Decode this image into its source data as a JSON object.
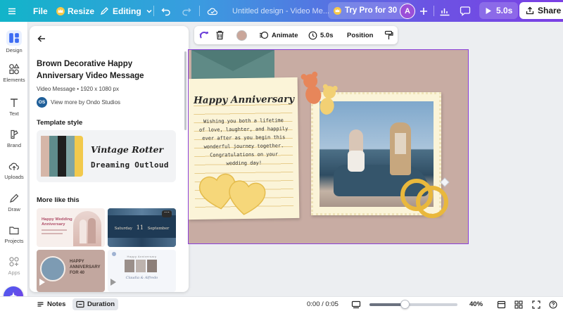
{
  "topbar": {
    "file_label": "File",
    "resize_label": "Resize",
    "editing_label": "Editing",
    "doc_title": "Untitled design - Video Me...",
    "try_pro_label": "Try Pro for 30 ...",
    "avatar_initial": "A",
    "duration_label": "5.0s",
    "share_label": "Share"
  },
  "rail": {
    "items": [
      {
        "label": "Design",
        "icon": "design-icon"
      },
      {
        "label": "Elements",
        "icon": "elements-icon"
      },
      {
        "label": "Text",
        "icon": "text-icon"
      },
      {
        "label": "Brand",
        "icon": "brand-icon"
      },
      {
        "label": "Uploads",
        "icon": "uploads-icon"
      },
      {
        "label": "Draw",
        "icon": "draw-icon"
      },
      {
        "label": "Projects",
        "icon": "projects-icon"
      },
      {
        "label": "Apps",
        "icon": "apps-icon"
      }
    ]
  },
  "panel": {
    "title": "Brown Decorative Happy Anniversary Video Message",
    "meta": "Video Message • 1920 x 1080 px",
    "author_badge": "OS",
    "author_link": "View more by Ondo Studios",
    "template_style_heading": "Template style",
    "palette": [
      "#d5b6a8",
      "#5f8c8c",
      "#1f1f1f",
      "#7fa4a4",
      "#f2c94c"
    ],
    "font_sample_1": "Vintage Rotter",
    "font_sample_2": "Dreaming Outloud",
    "more_like_this_heading": "More like this",
    "thumbnails": [
      {
        "text_1": "Happy Wedding",
        "text_2": "Anniversary"
      },
      {
        "text_1": "Saturday",
        "text_2": "11",
        "text_3": "September"
      },
      {
        "text_1": "HAPPY",
        "text_2": "ANNIVERSARY",
        "text_3": "FOR 40"
      },
      {
        "text_1": "Happy Anniversary",
        "text_2": "Claudia & Alfredo"
      }
    ]
  },
  "toolbar": {
    "animate_label": "Animate",
    "duration_label": "5.0s",
    "position_label": "Position",
    "color_swatch": "#c9a69a"
  },
  "canvas": {
    "heading": "Happy Anniversary",
    "message": [
      "Wishing you both a lifetime",
      "of love, laughter, and happily",
      "ever after as you begin this",
      "wonderful journey together.",
      "Congratulations on your",
      "wedding day!"
    ],
    "background": "#c8aca3"
  },
  "bottombar": {
    "notes_label": "Notes",
    "duration_label": "Duration",
    "time_label": "0:00 / 0:05",
    "zoom_label": "40%",
    "zoom_level": 0.4
  }
}
